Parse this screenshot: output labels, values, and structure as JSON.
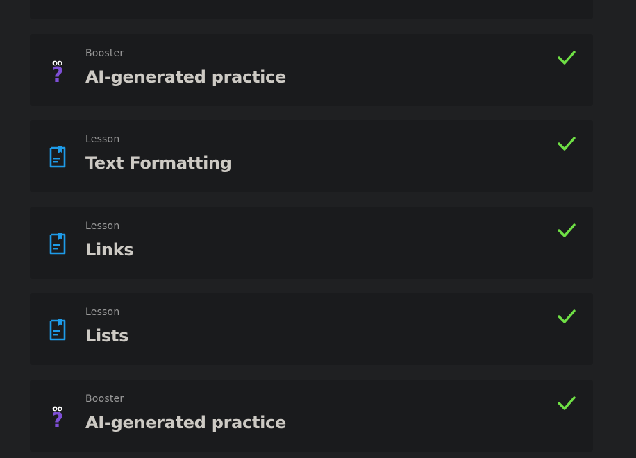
{
  "colors": {
    "page_bg": "#1f2022",
    "card_bg": "#1a1b1d",
    "check": "#6fe045",
    "lesson_icon": "#1e9be8",
    "booster_icon": "#7e4fd6",
    "title_text": "#cdcac4",
    "kind_text": "#9a9a9a"
  },
  "items": [
    {
      "kind": "Booster",
      "title": "AI-generated practice",
      "icon": "question-mark-booster-icon",
      "completed": true
    },
    {
      "kind": "Lesson",
      "title": "Text Formatting",
      "icon": "lesson-document-icon",
      "completed": true
    },
    {
      "kind": "Lesson",
      "title": "Links",
      "icon": "lesson-document-icon",
      "completed": true
    },
    {
      "kind": "Lesson",
      "title": "Lists",
      "icon": "lesson-document-icon",
      "completed": true
    },
    {
      "kind": "Booster",
      "title": "AI-generated practice",
      "icon": "question-mark-booster-icon",
      "completed": true
    }
  ]
}
